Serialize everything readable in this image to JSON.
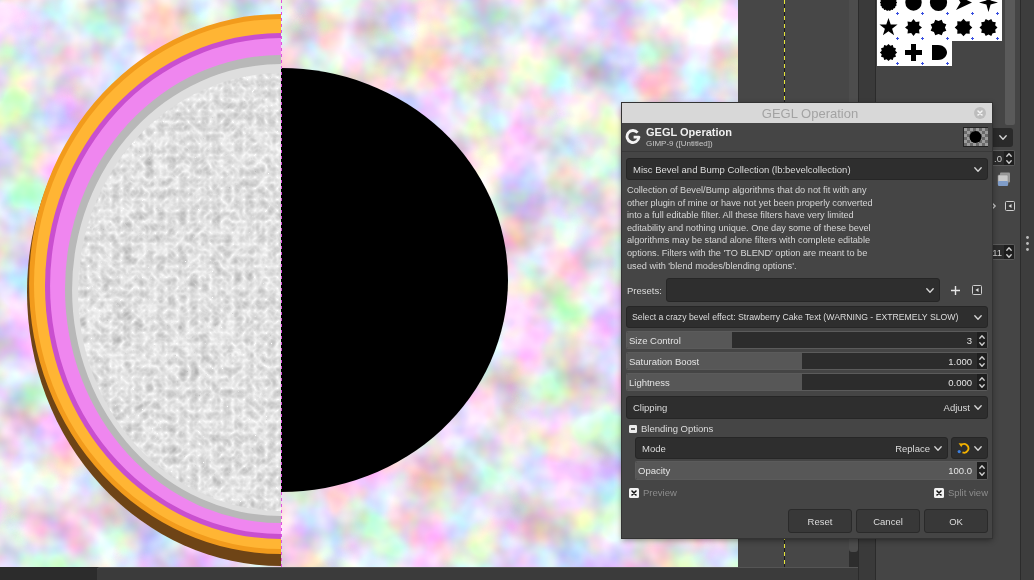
{
  "dock": {
    "spin_fields": [
      {
        "value": ".0"
      },
      {
        "value": "11"
      }
    ]
  },
  "dialog": {
    "title": "GEGL Operation",
    "header": {
      "title": "GEGL Operation",
      "subtitle": "GIMP-9 ([Untitled])"
    },
    "operation": {
      "value": "Misc Bevel and Bump Collection (lb:bevelcollection)"
    },
    "description": [
      "Collection of Bevel/Bump algorithms that do not fit with any",
      "other plugin of mine or have not yet been properly converted",
      "into a full editable filter. All these filters have very limited",
      "editability and nothing unique. One day some of these bevel",
      "algorithms may be stand alone filters with complete editable",
      "options. Filters with the 'TO BLEND' option are meant to be",
      "used with 'blend modes/blending options'."
    ],
    "presets": {
      "label": "Presets:"
    },
    "effect": {
      "value": "Select a crazy bevel effect: Strawberry Cake Text (WARNING - EXTREMELY SLOW)"
    },
    "sliders": [
      {
        "label": "Size Control",
        "value": "3",
        "level": 0.3
      },
      {
        "label": "Saturation Boost",
        "value": "1.000",
        "level": 0.5
      },
      {
        "label": "Lightness",
        "value": "0.000",
        "level": 0.5
      }
    ],
    "clipping": {
      "label": "Clipping",
      "value": "Adjust"
    },
    "blending": {
      "label": "Blending Options",
      "expanded": true,
      "mode": {
        "label": "Mode",
        "value": "Replace"
      },
      "opacity": {
        "label": "Opacity",
        "value": "100.0",
        "level": 1
      }
    },
    "checks": [
      {
        "label": "Preview",
        "checked": true
      },
      {
        "label": "Split view",
        "checked": true
      }
    ],
    "buttons": [
      {
        "label": "Reset"
      },
      {
        "label": "Cancel"
      },
      {
        "label": "OK"
      }
    ]
  }
}
